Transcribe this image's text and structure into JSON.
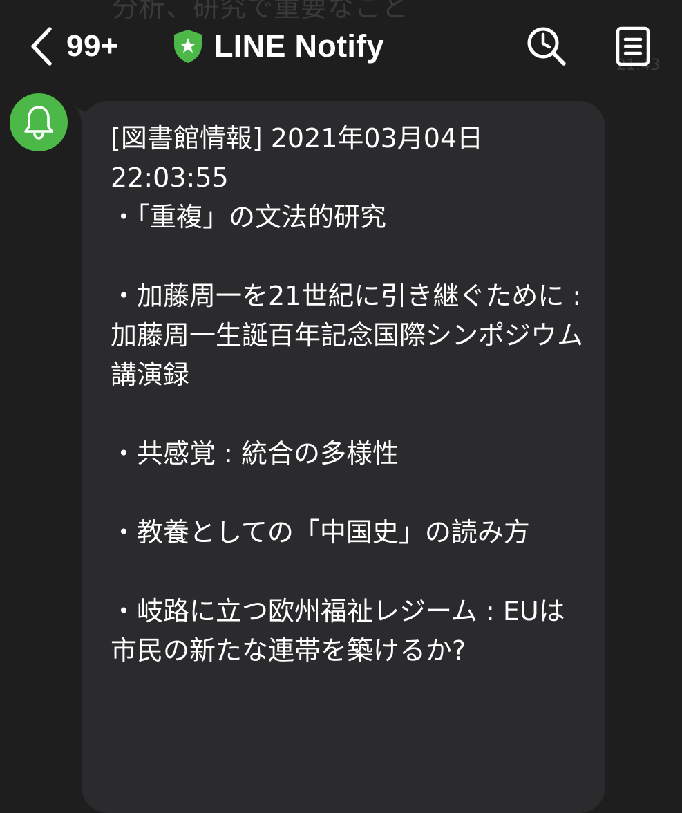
{
  "background_preview": {
    "text": "分析、研究で重要なこと",
    "time": "21:43"
  },
  "header": {
    "back_icon": "chevron-left-icon",
    "unread_count": "99+",
    "chat_icon": "shield-star-icon",
    "chat_title": "LINE Notify",
    "search_icon": "search-clock-icon",
    "menu_icon": "note-icon"
  },
  "message": {
    "avatar_icon": "bell-icon",
    "text": "[図書館情報] 2021年03月04日\n22:03:55\n・「重複」の文法的研究\n\n・加藤周一を21世紀に引き継ぐために : 加藤周一生誕百年記念国際シンポジウム講演録\n\n・共感覚 : 統合の多様性\n\n・教養としての「中国史」の読み方\n\n・岐路に立つ欧州福祉レジーム : EUは市民の新たな連帯を築けるか?"
  },
  "colors": {
    "background": "#1e1e1e",
    "bubble": "#2b2b2e",
    "accent_green": "#4cb847",
    "text": "#ffffff"
  }
}
